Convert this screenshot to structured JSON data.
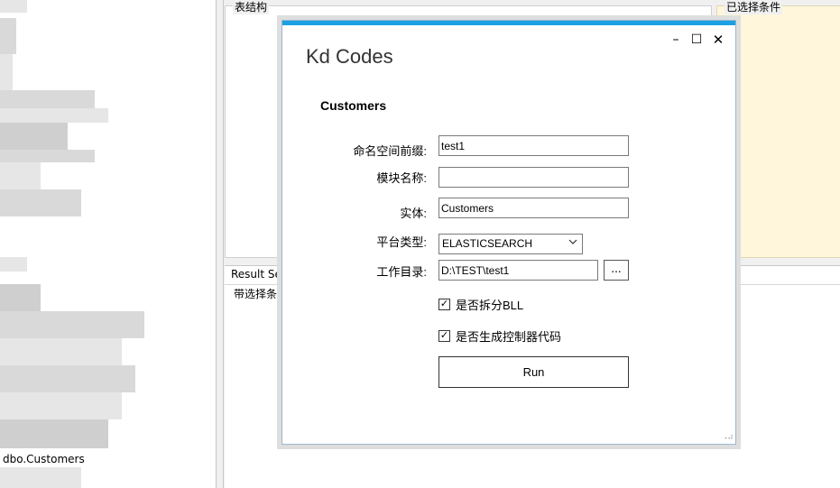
{
  "left_panel": {
    "selected_item": "dbo.Customers"
  },
  "main": {
    "struct_group_title": "表结构",
    "cond_group_title": "已选择条件",
    "result_tab_label": "Result Set",
    "filter_label": "带选择条件"
  },
  "dialog": {
    "title": "Kd Codes",
    "entity_name": "Customers",
    "window_buttons": {
      "minimize": "–",
      "maximize": "☐",
      "close": "✕"
    },
    "fields": {
      "namespace_label": "命名空间前缀:",
      "namespace_value": "test1",
      "module_label": "模块名称:",
      "module_value": "",
      "entity_label": "实体:",
      "entity_value": "Customers",
      "platform_label": "平台类型:",
      "platform_value": "ELASTICSEARCH",
      "workdir_label": "工作目录:",
      "workdir_value": "D:\\TEST\\test1",
      "browse_label": "..."
    },
    "checkboxes": {
      "split_bll_label": "是否拆分BLL",
      "split_bll_checked": true,
      "gen_controller_label": "是否生成控制器代码",
      "gen_controller_checked": true,
      "check_mark": "✓"
    },
    "run_label": "Run",
    "grip": "⠠⠴"
  },
  "icons": [
    "minimize-icon",
    "maximize-icon",
    "close-icon",
    "chevron-down-icon",
    "checkmark-icon",
    "resize-grip-icon"
  ],
  "colors": {
    "accent": "#1ba1e2",
    "cond_panel_bg": "#fff6dc"
  }
}
